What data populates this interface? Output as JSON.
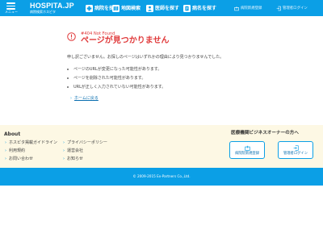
{
  "header": {
    "menu_label": "メニュー",
    "logo_text": "HOSPITA.JP",
    "logo_sub": "病院検索ホスピタ",
    "nav": [
      {
        "label": "病院を探す",
        "icon": "hospital-icon"
      },
      {
        "label": "地図検索",
        "icon": "map-icon"
      },
      {
        "label": "医師を探す",
        "icon": "doctor-icon"
      },
      {
        "label": "病名を探す",
        "icon": "disease-icon"
      }
    ],
    "utility": [
      {
        "label": "病院新規登録",
        "icon": "hospital-register-icon"
      },
      {
        "label": "管理者ログイン",
        "icon": "login-icon"
      }
    ]
  },
  "error": {
    "code": "#404 Not Found",
    "title": "ページが見つかりません",
    "message": "申し訳ございません。お探しのページはいずれかの理由により見つかりませんでした。",
    "reasons": [
      "ページのURLが変更になった可能性があります。",
      "ページを削除された可能性があります。",
      "URLが正しく入力されていない可能性があります。"
    ],
    "home_link": "ホームに戻る"
  },
  "footer": {
    "about_title": "About",
    "links_col1": [
      "ホスピタ掲載ガイドライン",
      "利用規約",
      "お問い合わせ"
    ],
    "links_col2": [
      "プライバシーポリシー",
      "運営会社",
      "お知らせ"
    ],
    "owner_title": "医療機関ビジネスオーナーの方へ",
    "owner_buttons": [
      {
        "label": "病院院新規登録",
        "icon": "hospital-register-icon"
      },
      {
        "label": "管理者ログイン",
        "icon": "login-icon"
      }
    ],
    "copyright": "© 2009-2015 Ex-Partners Co.,Ltd."
  },
  "colors": {
    "brand": "#0b9fe6",
    "error": "#e0393a",
    "footer_bg": "#fdf8e4"
  }
}
